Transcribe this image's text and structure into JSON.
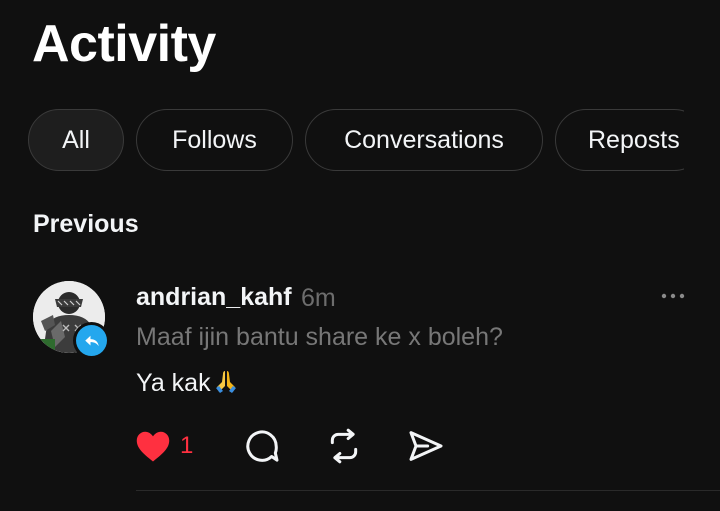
{
  "header": {
    "title": "Activity"
  },
  "filters": [
    {
      "label": "All",
      "active": true
    },
    {
      "label": "Follows",
      "active": false
    },
    {
      "label": "Conversations",
      "active": false
    },
    {
      "label": "Reposts",
      "active": false
    }
  ],
  "section": {
    "label": "Previous"
  },
  "notification": {
    "username": "andrian_kahf",
    "time": "6m",
    "quoted_text": "Maaf ijin bantu share ke x boleh?",
    "reply_text": "Ya kak",
    "reply_emoji": "folded-hands",
    "badge_icon": "reply-arrow-icon",
    "badge_color": "#24a7ee",
    "likes": "1",
    "liked": true,
    "like_color": "#ff3040"
  }
}
